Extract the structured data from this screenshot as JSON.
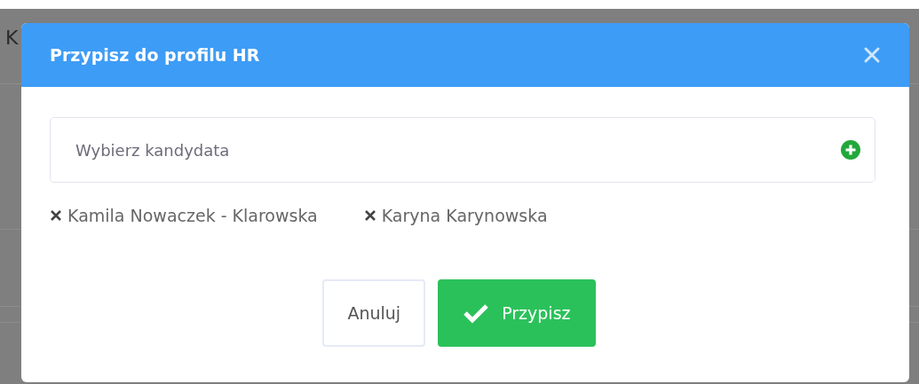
{
  "background": {
    "text": "K"
  },
  "dialog": {
    "title": "Przypisz do profilu HR",
    "field": {
      "placeholder": "Wybierz kandydata"
    },
    "selected_candidates": [
      {
        "name": "Kamila Nowaczek - Klarowska"
      },
      {
        "name": "Karyna Karynowska"
      }
    ],
    "buttons": [
      {
        "kind": "cancel",
        "label": "Anuluj"
      },
      {
        "kind": "confirm",
        "label": "Przypisz"
      }
    ]
  }
}
